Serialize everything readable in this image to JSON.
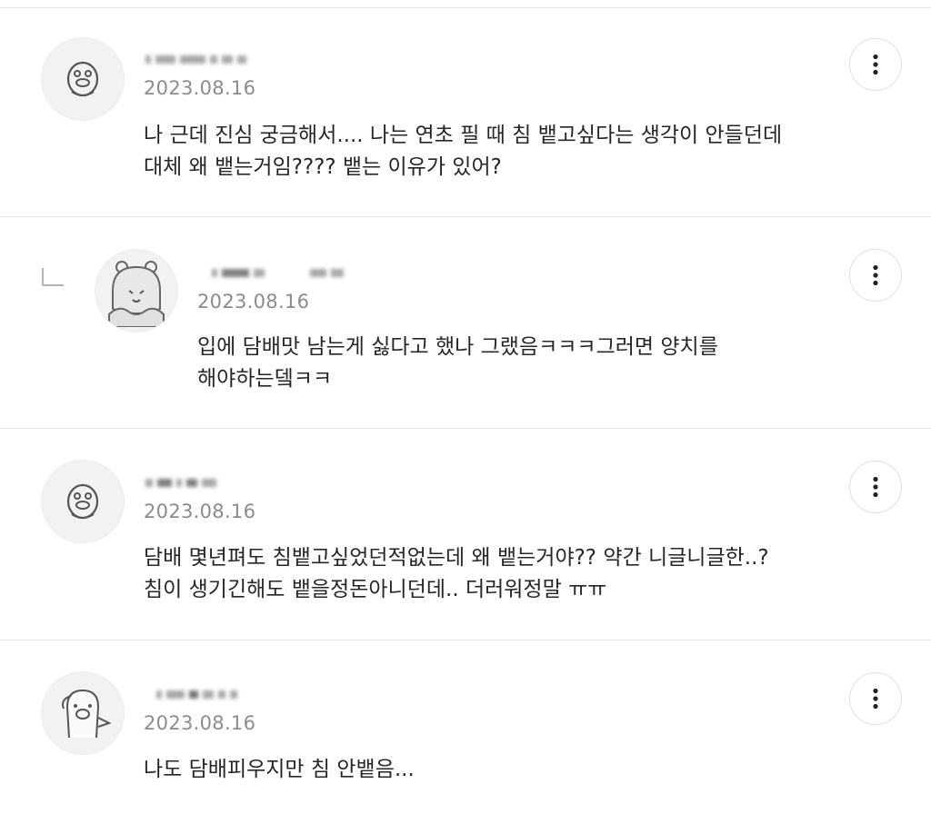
{
  "comments": [
    {
      "date": "2023.08.16",
      "lines": [
        "나 근데 진심 궁금해서.... 나는 연초 필 때 침 뱉고싶다는 생각이 안들던데",
        "대체 왜 뱉는거임???? 뱉는 이유가 있어?"
      ],
      "avatar_icon": "duck-character-icon"
    },
    {
      "date": "2023.08.16",
      "lines": [
        "입에 담배맛 남는게 싫다고 했나 그랬음ㅋㅋㅋ그러면 양치를",
        "해야하는뎈ㅋㅋ"
      ],
      "avatar_icon": "hamster-character-icon",
      "is_reply": true
    },
    {
      "date": "2023.08.16",
      "lines": [
        "담배 몇년펴도 침뱉고싶었던적없는데 왜 뱉는거야?? 약간 니글니글한..?",
        "침이 생기긴해도 뱉을정돈아니던데.. 더러워정말 ㅠㅠ"
      ],
      "avatar_icon": "duck-character-icon"
    },
    {
      "date": "2023.08.16",
      "lines": [
        "나도 담배피우지만 침 안뱉음..."
      ],
      "avatar_icon": "pig-character-icon"
    }
  ],
  "more_icon": "more-vertical-icon",
  "reply_icon": "reply-corner-icon"
}
